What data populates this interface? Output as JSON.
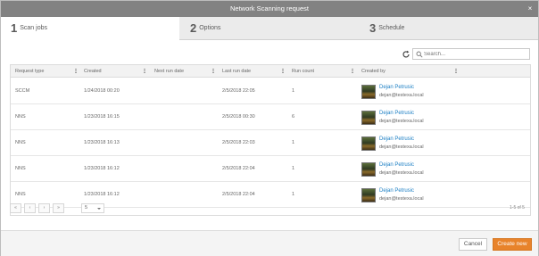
{
  "window": {
    "title": "Network Scanning request",
    "close_glyph": "×"
  },
  "tabs": [
    {
      "number": "1",
      "label": "Scan jobs",
      "active": true
    },
    {
      "number": "2",
      "label": "Options",
      "active": false
    },
    {
      "number": "3",
      "label": "Schedule",
      "active": false
    }
  ],
  "search": {
    "placeholder": "Search...",
    "value": ""
  },
  "table": {
    "columns": [
      "Request type",
      "Created",
      "Next run date",
      "Last run date",
      "Run count",
      "Created by"
    ],
    "rows": [
      {
        "type": "SCCM",
        "created": "1/24/2018 00:20",
        "next_run": "",
        "last_run": "2/5/2018 22:05",
        "run_count": "1",
        "user_name": "Dejan Petrusic",
        "user_email": "dejan@testexa.local"
      },
      {
        "type": "NNS",
        "created": "1/23/2018 16:15",
        "next_run": "",
        "last_run": "2/5/2018 00:30",
        "run_count": "6",
        "user_name": "Dejan Petrusic",
        "user_email": "dejan@testexa.local"
      },
      {
        "type": "NNS",
        "created": "1/23/2018 16:13",
        "next_run": "",
        "last_run": "2/5/2018 22:03",
        "run_count": "1",
        "user_name": "Dejan Petrusic",
        "user_email": "dejan@testexa.local"
      },
      {
        "type": "NNS",
        "created": "1/23/2018 16:12",
        "next_run": "",
        "last_run": "2/5/2018 22:04",
        "run_count": "1",
        "user_name": "Dejan Petrusic",
        "user_email": "dejan@testexa.local"
      },
      {
        "type": "NNS",
        "created": "1/23/2018 16:12",
        "next_run": "",
        "last_run": "2/5/2018 22:04",
        "run_count": "1",
        "user_name": "Dejan Petrusic",
        "user_email": "dejan@testexa.local"
      }
    ]
  },
  "pager": {
    "first": "«",
    "prev": "‹",
    "next": "›",
    "last": "»",
    "page_size": "5",
    "info": "1-5 of 5"
  },
  "footer": {
    "cancel_label": "Cancel",
    "create_label": "Create new"
  },
  "colors": {
    "accent": "#e8832b",
    "link": "#1c7fc4",
    "titlebar": "#828282"
  },
  "icons": {
    "refresh": "refresh-icon",
    "search": "search-icon",
    "close": "close-icon"
  }
}
